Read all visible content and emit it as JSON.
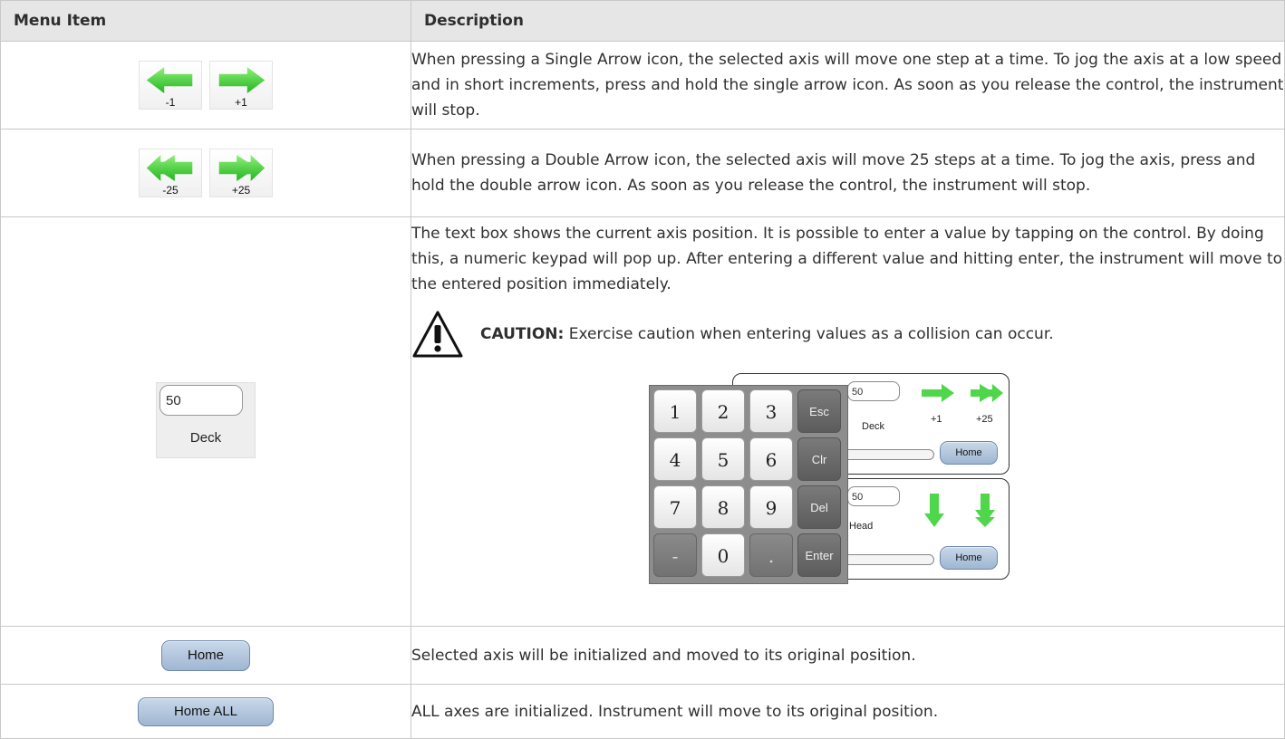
{
  "table": {
    "header": {
      "menu_item": "Menu Item",
      "description": "Description"
    },
    "rows": [
      {
        "description": "When pressing a Single Arrow icon, the selected axis will move one step at a time. To jog the axis at a low speed and in short increments, press and hold the single arrow icon. As soon as you release the control, the instrument will stop.",
        "icons": {
          "left_label": "-1",
          "right_label": "+1"
        }
      },
      {
        "description": "When pressing a Double Arrow icon, the selected axis will move 25 steps at a time. To jog the axis, press and hold the double arrow icon. As soon as you release the control, the instrument will stop.",
        "icons": {
          "left_label": "-25",
          "right_label": "+25"
        }
      },
      {
        "description": "The text box shows the current axis position. It is possible to enter a value by tapping on the control. By doing this, a numeric keypad will pop up. After entering a different value and hitting enter, the instrument will move to the entered position immediately.",
        "widget": {
          "value": "50",
          "label": "Deck"
        },
        "caution": {
          "label": "CAUTION:",
          "text": "Exercise caution when entering values as a collision can occur."
        },
        "figure": {
          "deck_panel": {
            "value": "50",
            "label": "Deck",
            "arrow1_label": "+1",
            "arrow2_label": "+25",
            "home_label": "Home"
          },
          "head_panel": {
            "value": "50",
            "label": "Head",
            "home_label": "Home"
          },
          "keypad": {
            "keys": [
              {
                "label": "1"
              },
              {
                "label": "2"
              },
              {
                "label": "3"
              },
              {
                "label": "Esc"
              },
              {
                "label": "4"
              },
              {
                "label": "5"
              },
              {
                "label": "6"
              },
              {
                "label": "Clr"
              },
              {
                "label": "7"
              },
              {
                "label": "8"
              },
              {
                "label": "9"
              },
              {
                "label": "Del"
              },
              {
                "label": "-"
              },
              {
                "label": "0"
              },
              {
                "label": "."
              },
              {
                "label": "Enter"
              }
            ]
          }
        }
      },
      {
        "button_label": "Home",
        "description": "Selected axis will be initialized and moved to its original position."
      },
      {
        "button_label": "Home ALL",
        "description": "ALL axes are initialized. Instrument will move to its original position."
      }
    ]
  },
  "colors": {
    "arrow_green": "#4fd64a",
    "header_bg": "#e6e6e6",
    "button_blue": "#a9bfd8"
  },
  "icons": [
    "single-left-arrow-icon",
    "single-right-arrow-icon",
    "double-left-arrow-icon",
    "double-right-arrow-icon",
    "warning-triangle-icon",
    "down-arrow-icon",
    "double-down-arrow-icon"
  ]
}
